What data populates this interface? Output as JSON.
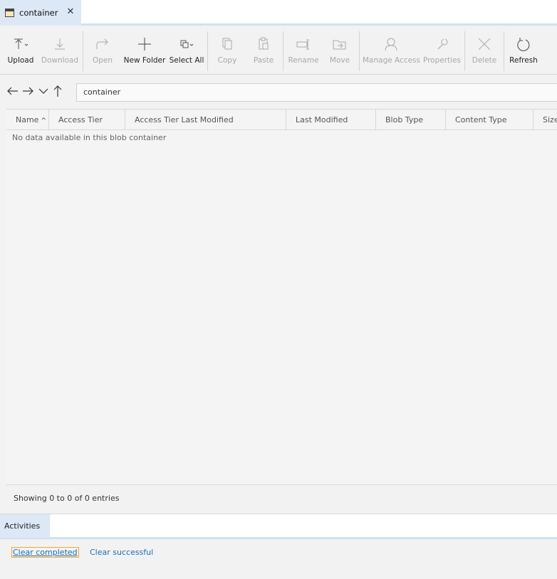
{
  "tab": {
    "title": "container",
    "close": "✕"
  },
  "toolbar": {
    "upload": "Upload",
    "download": "Download",
    "open": "Open",
    "new_folder": "New Folder",
    "select_all": "Select All",
    "copy": "Copy",
    "paste": "Paste",
    "rename": "Rename",
    "move": "Move",
    "manage_access": "Manage Access",
    "properties": "Properties",
    "delete": "Delete",
    "refresh": "Refresh"
  },
  "path": {
    "value": "container"
  },
  "table": {
    "columns": [
      "Name",
      "Access Tier",
      "Access Tier Last Modified",
      "Last Modified",
      "Blob Type",
      "Content Type",
      "Size"
    ],
    "sort_indicator": "^",
    "empty_message": "No data available in this blob container",
    "footer": "Showing 0 to 0 of 0 entries"
  },
  "activities": {
    "tab_label": "Activities",
    "clear_completed": "Clear completed",
    "clear_successful": "Clear successful"
  },
  "colors": {
    "accent": "#cfe1f5",
    "tab_active": "#dce8f6",
    "link": "#1a6fb5"
  }
}
